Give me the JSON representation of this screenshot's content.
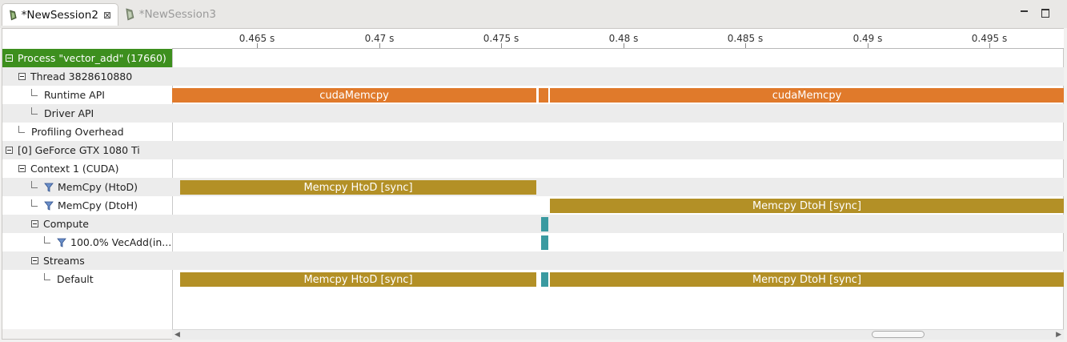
{
  "tabs": [
    {
      "label": "*NewSession2",
      "active": true,
      "close_icon": "close-icon"
    },
    {
      "label": "*NewSession3",
      "active": false
    }
  ],
  "window_controls": {
    "minimize": "minimize-icon",
    "maximize": "maximize-icon"
  },
  "ruler": {
    "ticks": [
      "0.465 s",
      "0.47 s",
      "0.475 s",
      "0.48 s",
      "0.485 s",
      "0.49 s",
      "0.495 s"
    ]
  },
  "tree": [
    {
      "label": "Process \"vector_add\" (17660)",
      "kind": "expander",
      "level": 0,
      "selected": true
    },
    {
      "label": "Thread 3828610880",
      "kind": "expander",
      "level": 1
    },
    {
      "label": "Runtime API",
      "kind": "leaf",
      "level": 2
    },
    {
      "label": "Driver API",
      "kind": "leaf",
      "level": 2
    },
    {
      "label": "Profiling Overhead",
      "kind": "leaf",
      "level": 1
    },
    {
      "label": "[0] GeForce GTX 1080 Ti",
      "kind": "expander",
      "level": 0
    },
    {
      "label": "Context 1 (CUDA)",
      "kind": "expander",
      "level": 1
    },
    {
      "label": "MemCpy (HtoD)",
      "kind": "filter",
      "level": 2
    },
    {
      "label": "MemCpy (DtoH)",
      "kind": "filter",
      "level": 2
    },
    {
      "label": "Compute",
      "kind": "expander",
      "level": 2
    },
    {
      "label": "100.0% VecAdd(in...",
      "kind": "filter",
      "level": 3
    },
    {
      "label": "Streams",
      "kind": "expander",
      "level": 2
    },
    {
      "label": "Default",
      "kind": "leaf",
      "level": 3
    }
  ],
  "timeline": {
    "colors": {
      "api": "#e07a2b",
      "memcpy": "#b39026",
      "kernel": "#3a9aa0",
      "selected": "#3d8f1e"
    },
    "runtime_api": {
      "left": "cudaMemcpy",
      "right": "cudaMemcpy"
    },
    "memcpy_htod": "Memcpy HtoD [sync]",
    "memcpy_dtoh": "Memcpy DtoH [sync]"
  }
}
